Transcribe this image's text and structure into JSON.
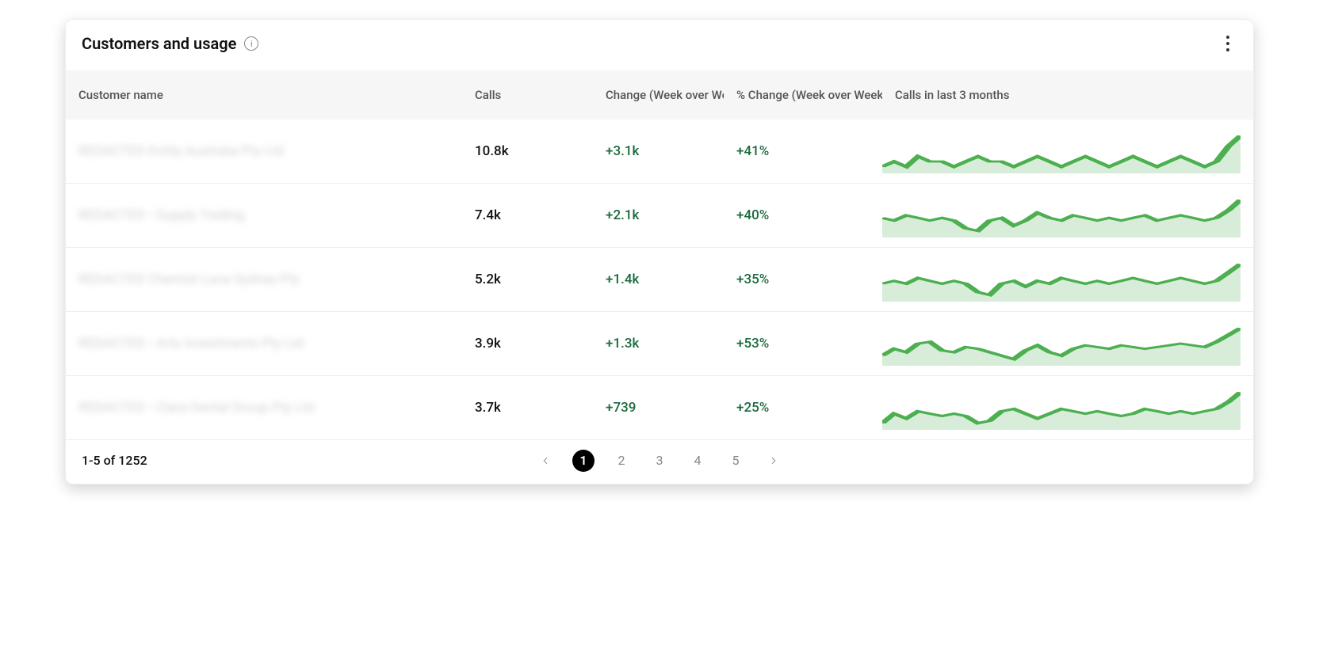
{
  "header": {
    "title": "Customers and usage"
  },
  "columns": {
    "name": "Customer name",
    "calls": "Calls",
    "change": "Change (Week over Week)",
    "pct": "% Change (Week over Week)",
    "spark": "Calls in last 3 months"
  },
  "rows": [
    {
      "name": "REDACTED Entity Australia Pty Ltd",
      "calls": "10.8k",
      "change": "+3.1k",
      "pct": "+41%",
      "spark": [
        32,
        33,
        32,
        34,
        33,
        33,
        32,
        33,
        34,
        33,
        33,
        32,
        33,
        34,
        33,
        32,
        33,
        34,
        33,
        32,
        33,
        34,
        33,
        32,
        33,
        34,
        33,
        32,
        33,
        36,
        38
      ]
    },
    {
      "name": "REDACTED • Supply Trading",
      "calls": "7.4k",
      "change": "+2.1k",
      "pct": "+40%",
      "spark": [
        34,
        33,
        35,
        34,
        33,
        34,
        33,
        30,
        29,
        33,
        34,
        31,
        33,
        36,
        34,
        33,
        35,
        34,
        33,
        34,
        33,
        34,
        35,
        33,
        34,
        35,
        34,
        33,
        34,
        37,
        41
      ]
    },
    {
      "name": "REDACTED Chemist Luna Sydney Pty",
      "calls": "5.2k",
      "change": "+1.4k",
      "pct": "+35%",
      "spark": [
        33,
        34,
        33,
        35,
        34,
        33,
        34,
        33,
        30,
        29,
        33,
        34,
        32,
        34,
        33,
        35,
        34,
        33,
        34,
        33,
        34,
        35,
        34,
        33,
        34,
        35,
        34,
        33,
        34,
        37,
        40
      ]
    },
    {
      "name": "REDACTED • Arts Investments Pty Ltd",
      "calls": "3.9k",
      "change": "+1.3k",
      "pct": "+53%",
      "spark": [
        28,
        32,
        30,
        35,
        36,
        31,
        30,
        33,
        32,
        30,
        28,
        26,
        31,
        34,
        30,
        28,
        32,
        34,
        33,
        32,
        34,
        33,
        32,
        33,
        34,
        35,
        34,
        33,
        36,
        40,
        44
      ]
    },
    {
      "name": "REDACTED • Clara Dental Group Pty Ltd",
      "calls": "3.7k",
      "change": "+739",
      "pct": "+25%",
      "spark": [
        30,
        34,
        32,
        35,
        34,
        33,
        34,
        33,
        30,
        31,
        35,
        36,
        34,
        32,
        34,
        36,
        35,
        34,
        35,
        34,
        33,
        34,
        36,
        35,
        34,
        35,
        34,
        35,
        36,
        39,
        43
      ]
    }
  ],
  "pagination": {
    "range": "1-5 of 1252",
    "pages": [
      "1",
      "2",
      "3",
      "4",
      "5"
    ],
    "active": "1"
  },
  "chart_data": {
    "type": "table",
    "title": "Customers and usage",
    "columns": [
      "Customer name",
      "Calls",
      "Change (Week over Week)",
      "% Change (Week over Week)"
    ],
    "rows": [
      [
        "(redacted)",
        "10.8k",
        "+3.1k",
        "+41%"
      ],
      [
        "(redacted)",
        "7.4k",
        "+2.1k",
        "+40%"
      ],
      [
        "(redacted)",
        "5.2k",
        "+1.4k",
        "+35%"
      ],
      [
        "(redacted)",
        "3.9k",
        "+1.3k",
        "+53%"
      ],
      [
        "(redacted)",
        "3.7k",
        "+739",
        "+25%"
      ]
    ],
    "note": "Each row also shows a sparkline of Calls in last 3 months (relative shape only)."
  }
}
